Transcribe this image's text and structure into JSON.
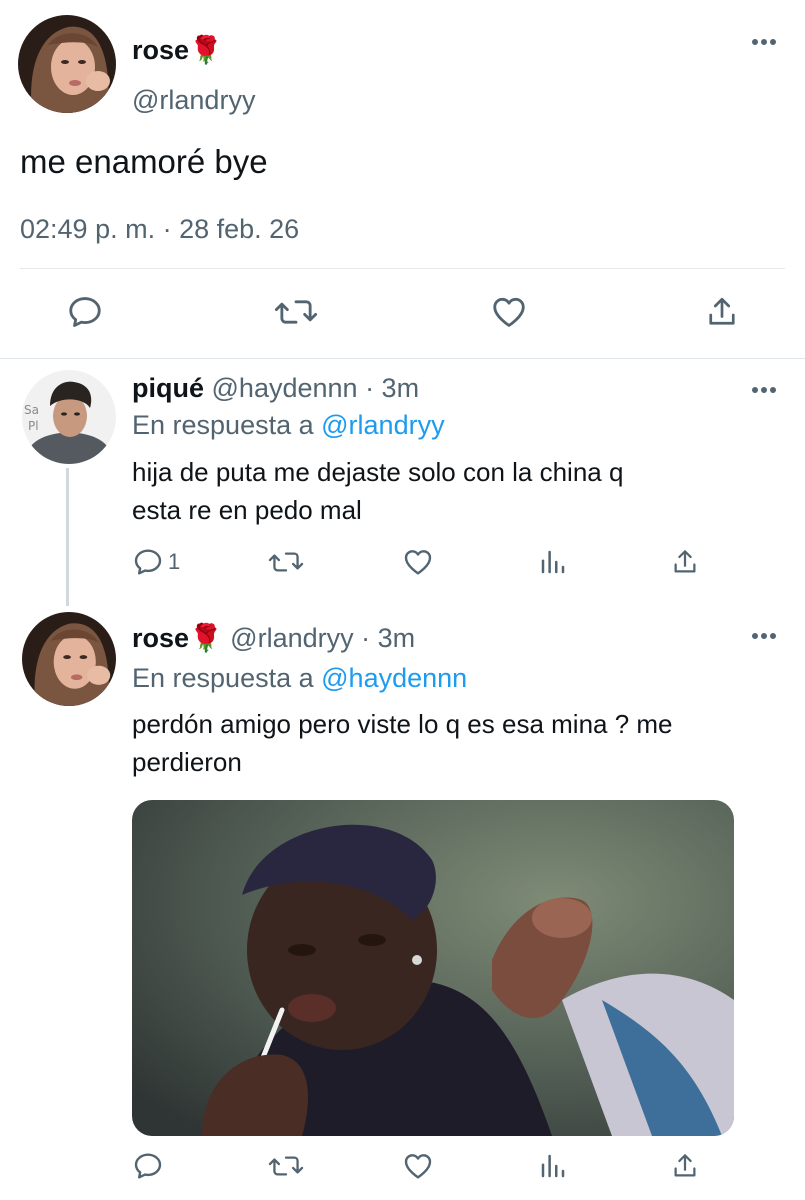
{
  "main_tweet": {
    "name": "rose🌹",
    "handle": "@rlandryy",
    "text": "me enamoré bye",
    "timestamp": "02:49 p. m. · 28 feb. 26",
    "icons": [
      "reply-icon",
      "retweet-icon",
      "like-icon",
      "share-icon",
      "more-icon"
    ]
  },
  "replies": [
    {
      "name": "piqué",
      "handle": "@haydennn",
      "time": "· 3m",
      "in_reply_label": "En respuesta a",
      "in_reply_to": "@rlandryy",
      "text_line1": "hija de puta me dejaste solo con la china q",
      "text_line2": "esta re en pedo mal",
      "reply_count": "1",
      "avatar_text": "Sa\nPI"
    },
    {
      "name": "rose🌹",
      "handle": "@rlandryy",
      "time": "· 3m",
      "in_reply_label": "En respuesta a",
      "in_reply_to": "@haydennn",
      "text_line1": "perdón amigo pero viste lo q es esa mina ? me",
      "text_line2": "perdieron",
      "reply_count": ""
    }
  ],
  "colors": {
    "accent": "#1d9bf0",
    "secondary_text": "#536471",
    "primary_text": "#0f1419",
    "divider": "#e6e9ec"
  }
}
